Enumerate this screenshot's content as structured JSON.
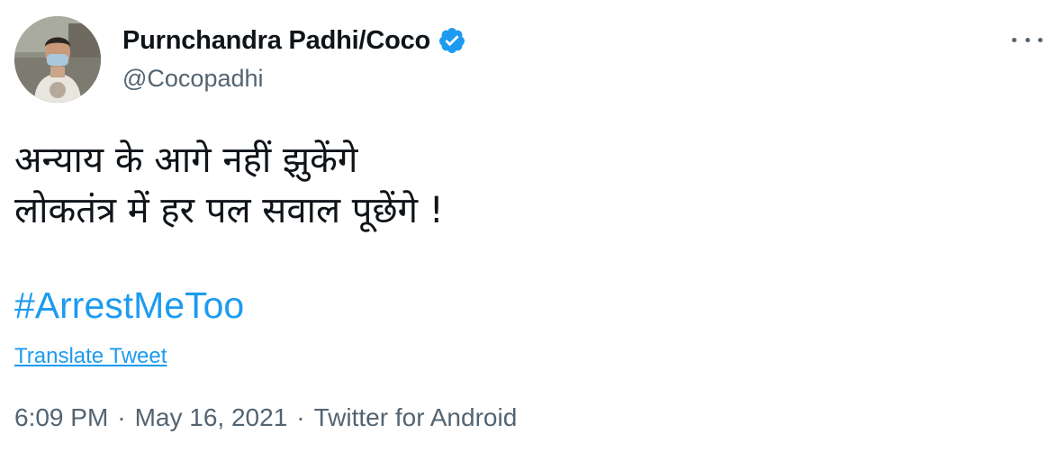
{
  "author": {
    "display_name": "Purnchandra Padhi/Coco",
    "handle": "@Cocopadhi",
    "verified": true,
    "avatar_icon": "profile-photo"
  },
  "menu": {
    "icon": "more-options-icon"
  },
  "tweet": {
    "lines": [
      "अन्याय के आगे नहीं झुकेंगे",
      "लोकतंत्र में हर पल सवाल पूछेंगे !"
    ],
    "hashtag": "#ArrestMeToo",
    "translate_label": "Translate Tweet"
  },
  "meta": {
    "time": "6:09 PM",
    "separator": "·",
    "date": "May 16, 2021",
    "source": "Twitter for Android"
  },
  "colors": {
    "link": "#1d9bf0",
    "secondary": "#536471",
    "primary": "#0f1419"
  }
}
